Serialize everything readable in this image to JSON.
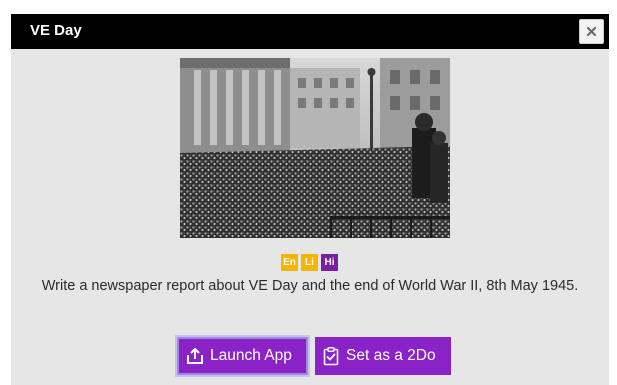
{
  "dialog": {
    "title": "VE Day",
    "close_icon": "close-icon",
    "close_glyph": "×"
  },
  "activity": {
    "levels": [
      {
        "label": "En",
        "color": "#f5b400"
      },
      {
        "label": "Li",
        "color": "#f5b400"
      },
      {
        "label": "Hi",
        "color": "#7a1fa2"
      }
    ],
    "description": "Write a newspaper report about VE Day and the end of World War II, 8th May 1945."
  },
  "actions": {
    "launch_label": "Launch App",
    "launch_icon": "upload-icon",
    "todo_label": "Set as a 2Do",
    "todo_icon": "clipboard-check-icon",
    "accent": "#8a22c8"
  }
}
